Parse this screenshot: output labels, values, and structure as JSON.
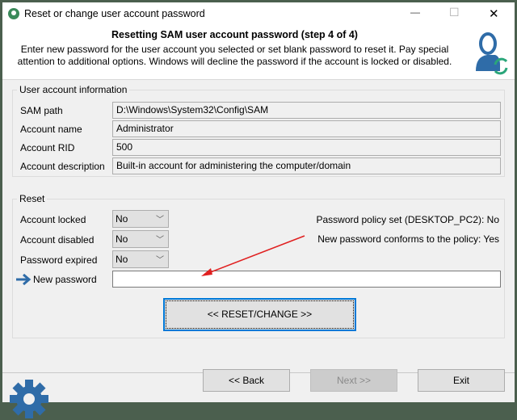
{
  "window": {
    "title": "Reset or change user account password",
    "minimize": "—",
    "maximize": "☐",
    "close": "✕"
  },
  "header": {
    "title": "Resetting SAM user account password (step 4 of 4)",
    "description_line1": "Enter new password for the user account you selected or set blank password to reset it. Pay special",
    "description_line2": "attention to additional options. Windows will decline the password if the account is locked or disabled."
  },
  "account_info": {
    "legend": "User account information",
    "rows": [
      {
        "label": "SAM path",
        "value": "D:\\Windows\\System32\\Config\\SAM"
      },
      {
        "label": "Account name",
        "value": "Administrator"
      },
      {
        "label": "Account RID",
        "value": "500"
      },
      {
        "label": "Account description",
        "value": "Built-in account for administering the computer/domain"
      }
    ]
  },
  "reset": {
    "legend": "Reset",
    "options": [
      {
        "label": "Account locked",
        "value": "No"
      },
      {
        "label": "Account disabled",
        "value": "No"
      },
      {
        "label": "Password expired",
        "value": "No"
      }
    ],
    "policy_set": "Password policy set (DESKTOP_PC2): No",
    "policy_conforms": "New password conforms to the policy: Yes",
    "new_password_label": "New password",
    "new_password_value": "",
    "reset_button": "<<  RESET/CHANGE  >>"
  },
  "footer": {
    "back": "<< Back",
    "next": "Next >>",
    "exit": "Exit"
  },
  "colors": {
    "accent": "#2f6ca8",
    "arrow": "#e02020",
    "frame": "#4b5f4e"
  }
}
